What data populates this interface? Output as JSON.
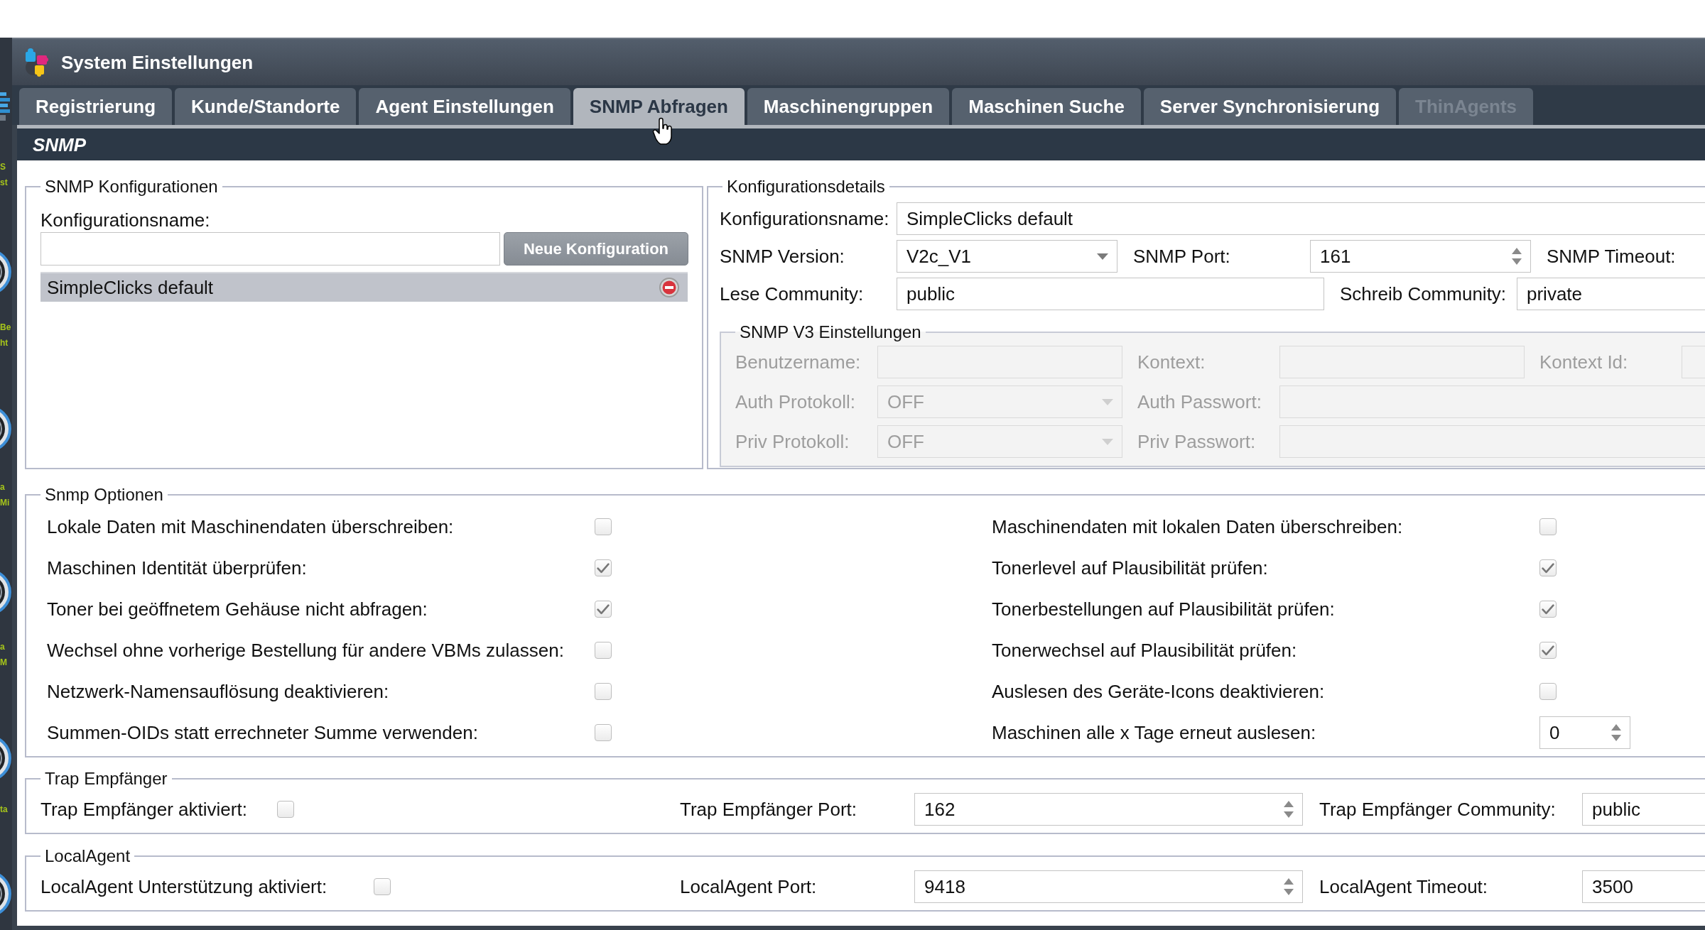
{
  "desktop": {
    "icons": [
      {
        "lines": [
          "S",
          "st"
        ]
      },
      {
        "lines": [
          "Be",
          "ht"
        ]
      },
      {
        "lines": [
          "a",
          "Mi"
        ]
      },
      {
        "lines": [
          "a",
          "M"
        ]
      },
      {
        "lines": [
          "ta"
        ]
      }
    ]
  },
  "window": {
    "title": "System Einstellungen"
  },
  "tabs": [
    {
      "label": "Registrierung",
      "selected": false,
      "disabled": false
    },
    {
      "label": "Kunde/Standorte",
      "selected": false,
      "disabled": false
    },
    {
      "label": "Agent Einstellungen",
      "selected": false,
      "disabled": false
    },
    {
      "label": "SNMP Abfragen",
      "selected": true,
      "disabled": false
    },
    {
      "label": "Maschinengruppen",
      "selected": false,
      "disabled": false
    },
    {
      "label": "Maschinen Suche",
      "selected": false,
      "disabled": false
    },
    {
      "label": "Server Synchronisierung",
      "selected": false,
      "disabled": false
    },
    {
      "label": "ThinAgents",
      "selected": false,
      "disabled": true
    }
  ],
  "section_title": "SNMP",
  "configurations": {
    "legend": "SNMP Konfigurationen",
    "name_label": "Konfigurationsname:",
    "new_button": "Neue Konfiguration",
    "items": [
      {
        "label": "SimpleClicks default",
        "selected": true
      }
    ]
  },
  "details": {
    "legend": "Konfigurationsdetails",
    "rows": [
      [
        {
          "label": "Konfigurationsname:",
          "field": {
            "kind": "text",
            "value": "SimpleClicks default"
          }
        }
      ],
      [
        {
          "label": "SNMP Version:",
          "field": {
            "kind": "select",
            "value": "V2c_V1"
          }
        },
        {
          "label": "SNMP Port:",
          "field": {
            "kind": "spinner",
            "value": "161"
          }
        },
        {
          "label": "SNMP Timeout:"
        }
      ],
      [
        {
          "label": "Lese Community:",
          "field": {
            "kind": "text",
            "value": "public"
          }
        },
        {
          "label": "Schreib Community:",
          "field": {
            "kind": "text",
            "value": "private"
          }
        }
      ]
    ],
    "v3": {
      "legend": "SNMP V3 Einstellungen",
      "disabled": true,
      "rows": [
        [
          {
            "label": "Benutzername:",
            "field": {
              "kind": "text"
            }
          },
          {
            "label": "Kontext:",
            "field": {
              "kind": "text"
            }
          },
          {
            "label": "Kontext Id:",
            "field": {
              "kind": "text"
            }
          }
        ],
        [
          {
            "label": "Auth Protokoll:",
            "field": {
              "kind": "select",
              "value": "OFF"
            }
          },
          {
            "label": "Auth Passwort:",
            "field": {
              "kind": "text"
            }
          }
        ],
        [
          {
            "label": "Priv Protokoll:",
            "field": {
              "kind": "select",
              "value": "OFF"
            }
          },
          {
            "label": "Priv Passwort:",
            "field": {
              "kind": "text"
            }
          }
        ]
      ]
    }
  },
  "options": {
    "legend": "Snmp Optionen",
    "items": [
      {
        "label": "Lokale Daten mit Maschinendaten überschreiben:",
        "kind": "checkbox",
        "checked": false
      },
      {
        "label": "Maschinendaten mit lokalen Daten überschreiben:",
        "kind": "checkbox",
        "checked": false
      },
      {
        "label": "Maschinen Identität überprüfen:",
        "kind": "checkbox",
        "checked": true
      },
      {
        "label": "Tonerlevel auf Plausibilität prüfen:",
        "kind": "checkbox",
        "checked": true
      },
      {
        "label": "Toner bei geöffnetem Gehäuse nicht abfragen:",
        "kind": "checkbox",
        "checked": true
      },
      {
        "label": "Tonerbestellungen auf Plausibilität prüfen:",
        "kind": "checkbox",
        "checked": true
      },
      {
        "label": "Wechsel ohne vorherige Bestellung für andere VBMs zulassen:",
        "kind": "checkbox",
        "checked": false
      },
      {
        "label": "Tonerwechsel auf Plausibilität prüfen:",
        "kind": "checkbox",
        "checked": true
      },
      {
        "label": "Netzwerk-Namensauflösung deaktivieren:",
        "kind": "checkbox",
        "checked": false
      },
      {
        "label": "Auslesen des Geräte-Icons deaktivieren:",
        "kind": "checkbox",
        "checked": false
      },
      {
        "label": "Summen-OIDs statt errechneter Summe verwenden:",
        "kind": "checkbox",
        "checked": false
      },
      {
        "label": "Maschinen alle x Tage erneut auslesen:",
        "kind": "spinner",
        "value": "0"
      }
    ]
  },
  "trap_receiver": {
    "legend": "Trap Empfänger",
    "items": [
      {
        "label": "Trap Empfänger aktiviert:",
        "kind": "checkbox",
        "checked": false
      },
      {
        "label": "Trap Empfänger Port:",
        "kind": "spinner",
        "value": "162"
      },
      {
        "label": "Trap Empfänger Community:",
        "kind": "text",
        "value": "public"
      }
    ]
  },
  "local_agent": {
    "legend": "LocalAgent",
    "items": [
      {
        "label": "LocalAgent Unterstützung aktiviert:",
        "kind": "checkbox",
        "checked": false
      },
      {
        "label": "LocalAgent Port:",
        "kind": "spinner",
        "value": "9418"
      },
      {
        "label": "LocalAgent Timeout:",
        "kind": "text",
        "value": "3500"
      }
    ]
  }
}
